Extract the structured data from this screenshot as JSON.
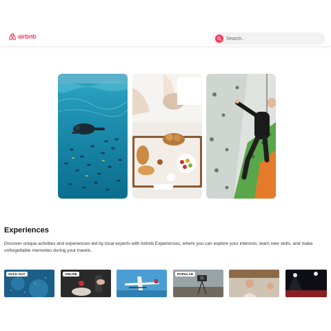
{
  "header": {
    "logo_text": "airbnb",
    "search": {
      "placeholder": "Search..",
      "value": ""
    }
  },
  "colors": {
    "brand": "#ff385c"
  },
  "hero": [
    {
      "icon": "snorkeling-photo"
    },
    {
      "icon": "breakfast-tray-photo"
    },
    {
      "icon": "rock-climbing-photo"
    }
  ],
  "experiences": {
    "title": "Experiences",
    "description": "Discover unique activities and experiences led by local experts with Airbnb Experiences, where you can explore your interests, learn new skills, and make unforgettable memories during your travels.",
    "cards": [
      {
        "badge": "SOLD OUT"
      },
      {
        "badge": "ONLINE"
      },
      {
        "badge": ""
      },
      {
        "badge": "POPULAR"
      },
      {
        "badge": ""
      },
      {
        "badge": ""
      }
    ]
  }
}
